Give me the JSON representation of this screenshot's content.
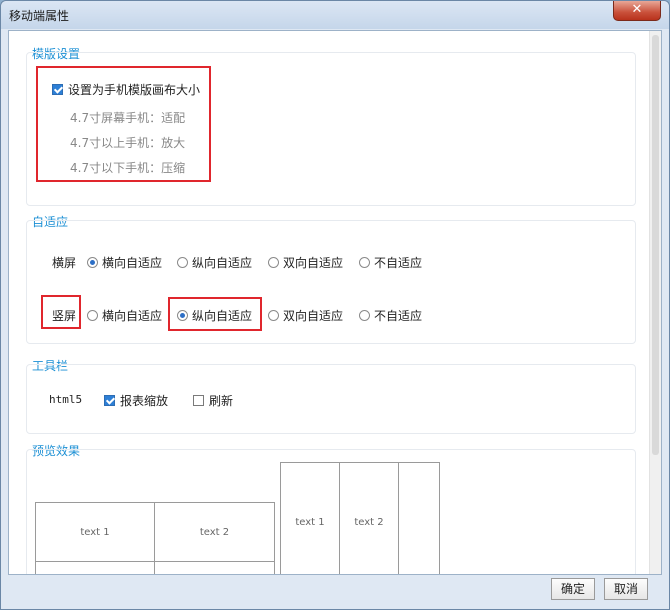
{
  "window": {
    "title": "移动端属性",
    "close_symbol": "✕"
  },
  "template_section": {
    "label": "模版设置",
    "checkbox_label": "设置为手机模版画布大小",
    "checked": true,
    "hints": [
      "4.7寸屏幕手机：适配",
      "4.7寸以上手机：放大",
      "4.7寸以下手机：压缩"
    ]
  },
  "adaptive_section": {
    "label": "自适应",
    "landscape_label": "横屏",
    "portrait_label": "竖屏",
    "options": [
      "横向自适应",
      "纵向自适应",
      "双向自适应",
      "不自适应"
    ],
    "landscape_selected": "横向自适应",
    "portrait_selected": "纵向自适应"
  },
  "toolbar_section": {
    "label": "工具栏",
    "platform": "html5",
    "report_zoom_label": "报表缩放",
    "report_zoom_checked": true,
    "refresh_label": "刷新",
    "refresh_checked": false
  },
  "preview_section": {
    "label": "预览效果",
    "cells": [
      "text 1",
      "text 2",
      "text 1",
      "text 2"
    ]
  },
  "buttons": {
    "ok": "确定",
    "cancel": "取消"
  }
}
